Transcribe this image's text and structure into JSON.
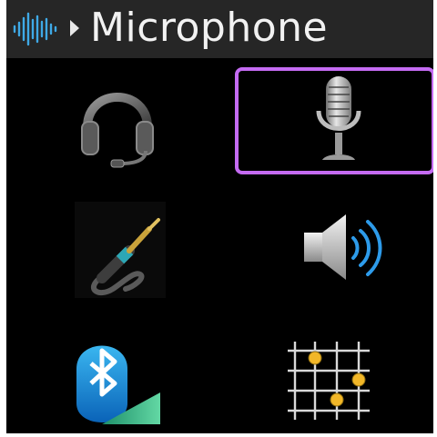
{
  "header": {
    "title": "Microphone",
    "logo_icon": "sound-wave-icon",
    "arrow_icon": "chevron-right-icon"
  },
  "menu": {
    "selected_index": 1,
    "selection_color": "#c46bf2",
    "items": [
      {
        "icon": "headset-icon"
      },
      {
        "icon": "microphone-icon"
      },
      {
        "icon": "audio-jack-icon"
      },
      {
        "icon": "speaker-icon"
      },
      {
        "icon": "bluetooth-icon"
      },
      {
        "icon": "equalizer-grid-icon"
      }
    ]
  }
}
